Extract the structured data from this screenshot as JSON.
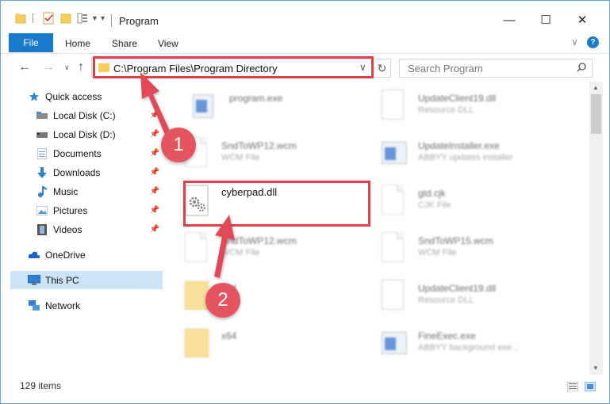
{
  "window": {
    "title": "Program",
    "minimize": "—",
    "maximize": "☐",
    "close": "✕"
  },
  "ribbon": {
    "file": "File",
    "home": "Home",
    "share": "Share",
    "view": "View",
    "help": "?"
  },
  "address": {
    "path": "C:\\Program Files\\Program Directory",
    "search_placeholder": "Search Program"
  },
  "sidebar": {
    "items": [
      {
        "label": "Quick access",
        "icon": "star-icon",
        "pinned": false
      },
      {
        "label": "Local Disk (C:)",
        "icon": "drive-icon",
        "pinned": true
      },
      {
        "label": "Local Disk (D:)",
        "icon": "drive-icon",
        "pinned": true
      },
      {
        "label": "Documents",
        "icon": "documents-icon",
        "pinned": true
      },
      {
        "label": "Downloads",
        "icon": "download-icon",
        "pinned": true
      },
      {
        "label": "Music",
        "icon": "music-icon",
        "pinned": true
      },
      {
        "label": "Pictures",
        "icon": "pictures-icon",
        "pinned": true
      },
      {
        "label": "Videos",
        "icon": "videos-icon",
        "pinned": true
      },
      {
        "label": "OneDrive",
        "icon": "cloud-icon",
        "pinned": false
      },
      {
        "label": "This PC",
        "icon": "computer-icon",
        "pinned": false,
        "selected": true
      },
      {
        "label": "Network",
        "icon": "network-icon",
        "pinned": false
      }
    ]
  },
  "files": {
    "left": [
      {
        "name": "program.exe",
        "type": "",
        "icon": "exe-icon"
      },
      {
        "name": "SndToWP12.wcm",
        "type": "WCM File",
        "icon": "document-icon"
      },
      {
        "name": "cyberpad.dll",
        "type": "",
        "icon": "gear-document-icon"
      },
      {
        "name": "SndToWP12.wcm",
        "type": "WCM File",
        "icon": "document-icon"
      },
      {
        "name": "x64",
        "type": "",
        "icon": "folder-icon"
      },
      {
        "name": "x64",
        "type": "",
        "icon": "folder-icon"
      }
    ],
    "right": [
      {
        "name": "UpdateClient19.dll",
        "type": "Resource DLL",
        "icon": "gear-document-icon"
      },
      {
        "name": "UpdateInstaller.exe",
        "type": "ABBYY updates installer",
        "icon": "exe-icon"
      },
      {
        "name": "gtd.cjk",
        "type": "CJK File",
        "icon": "document-icon"
      },
      {
        "name": "SndToWP15.wcm",
        "type": "WCM File",
        "icon": "document-icon"
      },
      {
        "name": "UpdateClient19.dll",
        "type": "Resource DLL",
        "icon": "gear-document-icon"
      },
      {
        "name": "FineExec.exe",
        "type": "ABBYY background exe...",
        "icon": "exe-icon"
      }
    ]
  },
  "status": {
    "count": "129 items"
  },
  "annotations": {
    "step1": "1",
    "step2": "2"
  },
  "colors": {
    "accent": "#1979ca",
    "highlight": "#e0404a",
    "annotation": "#e45560",
    "selected": "#cce4f7"
  }
}
